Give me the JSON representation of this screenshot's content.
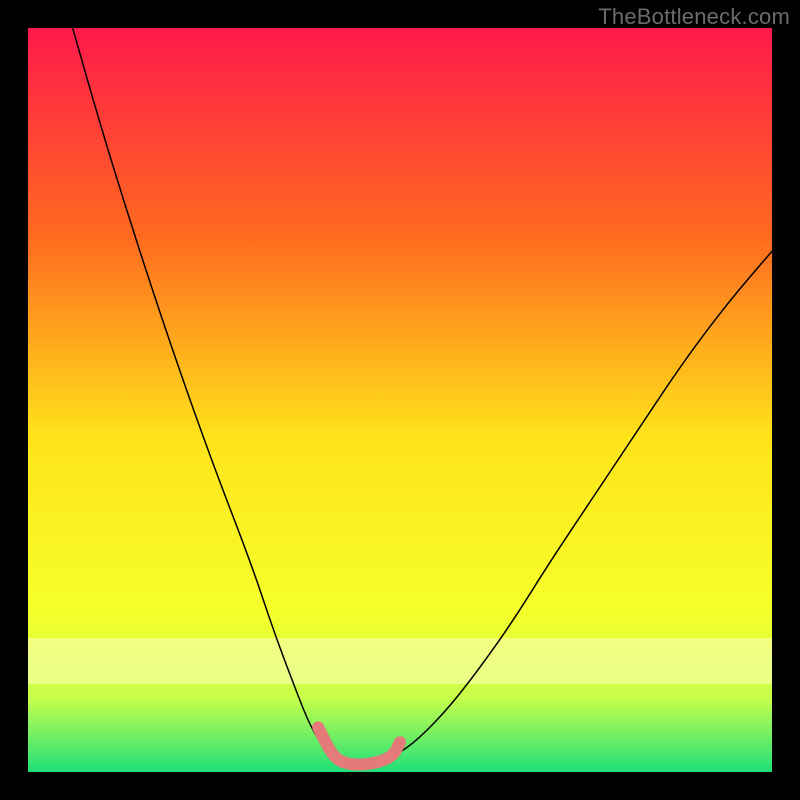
{
  "watermark": "TheBottleneck.com",
  "chart_data": {
    "type": "line",
    "title": "",
    "xlabel": "",
    "ylabel": "",
    "xlim": [
      0,
      100
    ],
    "ylim": [
      0,
      100
    ],
    "grid": false,
    "background_gradient": {
      "top": "#ff1a4b",
      "mid_upper": "#ff8a1f",
      "mid": "#ffe31a",
      "mid_lower": "#f3ff2a",
      "band": "#c8ff4a",
      "bottom": "#1fe07a"
    },
    "series": [
      {
        "name": "left-curve",
        "x": [
          6,
          10,
          15,
          20,
          25,
          30,
          33,
          36,
          38,
          40,
          41
        ],
        "y": [
          100,
          86,
          70,
          55,
          41,
          28,
          19,
          11,
          6,
          3,
          2
        ],
        "color": "#000000",
        "weight": 1.5
      },
      {
        "name": "right-curve",
        "x": [
          49,
          52,
          56,
          60,
          65,
          70,
          76,
          82,
          88,
          94,
          100
        ],
        "y": [
          2,
          4,
          8,
          13,
          20,
          28,
          37,
          46,
          55,
          63,
          70
        ],
        "color": "#000000",
        "weight": 1.5
      },
      {
        "name": "pink-marker",
        "x": [
          39,
          41,
          43,
          46,
          49,
          50
        ],
        "y": [
          6,
          2,
          1,
          1,
          2,
          4
        ],
        "color": "#e57a7a",
        "weight": 12
      }
    ]
  }
}
